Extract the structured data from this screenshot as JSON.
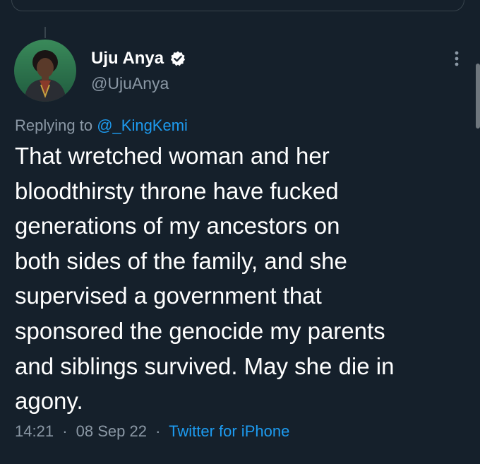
{
  "colors": {
    "background": "#15202b",
    "text_primary": "#ffffff",
    "text_secondary": "#8b98a5",
    "link": "#1d9bf0",
    "border": "#38444d"
  },
  "tweet": {
    "author": {
      "display_name": "Uju Anya",
      "handle": "@UjuAnya",
      "verified_icon": "verified-badge-icon",
      "avatar_icon": "profile-photo"
    },
    "replying_prefix": "Replying to",
    "replying_mention": "@_KingKemi",
    "text_lines": [
      "That wretched woman and her",
      "bloodthirsty throne have fucked",
      "generations of my ancestors on",
      "both sides of the family, and she",
      "supervised a government that",
      "sponsored the genocide my parents",
      "and siblings survived. May she die in",
      "agony."
    ],
    "time": "14:21",
    "separator": "·",
    "date": "08 Sep 22",
    "source": "Twitter for iPhone",
    "more_icon": "more-vertical-icon"
  }
}
